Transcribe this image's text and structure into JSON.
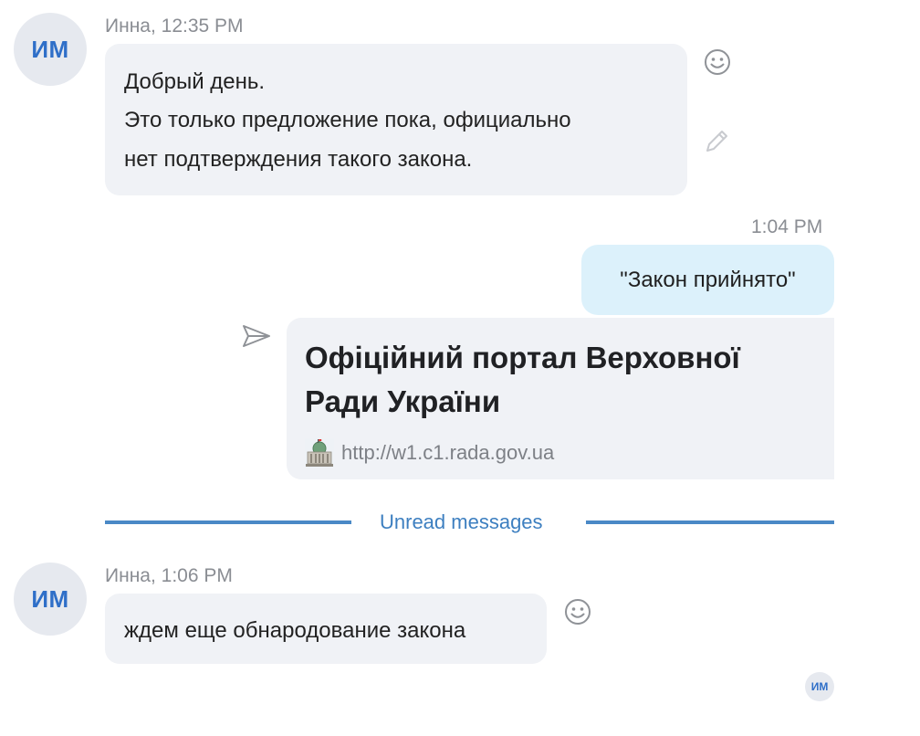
{
  "messages": [
    {
      "avatar_initials": "ИМ",
      "sender": "Инна",
      "time": "12:35 PM",
      "lines": [
        "Добрый день.",
        "Это только предложение пока, официально",
        "нет подтверждения такого закона."
      ]
    },
    {
      "time": "1:04 PM",
      "text": "\"Закон прийнято\"",
      "link_preview": {
        "title_lines": [
          "Офіційний портал Верховної",
          "Ради України"
        ],
        "url": "http://w1.c1.rada.gov.ua",
        "favicon": "parliament-building-icon"
      }
    },
    {
      "avatar_initials": "ИМ",
      "sender": "Инна",
      "time": "1:06 PM",
      "text": "ждем еще обнародование закона"
    }
  ],
  "divider": {
    "label": "Unread messages"
  },
  "read_receipt": {
    "initials": "ИМ"
  },
  "icons": {
    "reaction": "smiley-icon",
    "edit": "pencil-icon",
    "forward": "send-icon"
  },
  "colors": {
    "incoming_bubble": "#f0f2f6",
    "outgoing_bubble": "#dcf1fb",
    "accent": "#4a89c6",
    "avatar_text": "#2f6fc8",
    "meta_text": "#8a8d93"
  }
}
